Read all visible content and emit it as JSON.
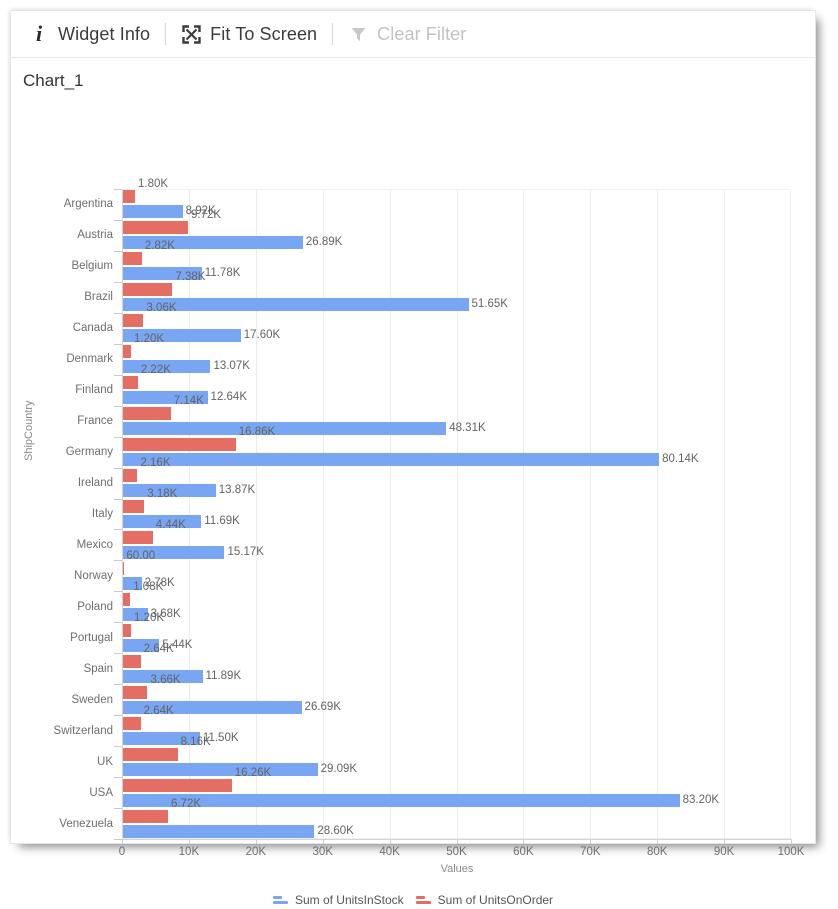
{
  "toolbar": {
    "items": [
      {
        "id": "widget-info",
        "label": "Widget Info",
        "icon": "info-icon",
        "disabled": false
      },
      {
        "id": "fit-to-screen",
        "label": "Fit To Screen",
        "icon": "fit-to-screen-icon",
        "disabled": false
      },
      {
        "id": "clear-filter",
        "label": "Clear Filter",
        "icon": "funnel-icon",
        "disabled": true
      }
    ]
  },
  "chart_title": "Chart_1",
  "colors": {
    "series_in_stock": "#78a6f2",
    "series_on_order": "#e46e64",
    "grid": "#ececec",
    "axis": "#d4d4d4",
    "label_text": "#636363"
  },
  "chart_data": {
    "type": "bar",
    "orientation": "horizontal",
    "title": "Chart_1",
    "xlabel": "Values",
    "ylabel": "ShipCountry",
    "xlim": [
      0,
      100000
    ],
    "xticks": [
      0,
      10000,
      20000,
      30000,
      40000,
      50000,
      60000,
      70000,
      80000,
      90000,
      100000
    ],
    "xtick_labels": [
      "0",
      "10K",
      "20K",
      "30K",
      "40K",
      "50K",
      "60K",
      "70K",
      "80K",
      "90K",
      "100K"
    ],
    "grid": true,
    "legend_position": "bottom",
    "categories": [
      "Argentina",
      "Austria",
      "Belgium",
      "Brazil",
      "Canada",
      "Denmark",
      "Finland",
      "France",
      "Germany",
      "Ireland",
      "Italy",
      "Mexico",
      "Norway",
      "Poland",
      "Portugal",
      "Spain",
      "Sweden",
      "Switzerland",
      "UK",
      "USA",
      "Venezuela"
    ],
    "series": [
      {
        "name": "Sum of UnitsInStock",
        "color": "#78a6f2",
        "values": [
          8920,
          26890,
          11780,
          51650,
          17600,
          13070,
          12640,
          48310,
          80140,
          13870,
          11690,
          15170,
          2780,
          3680,
          5440,
          11890,
          26690,
          11500,
          29090,
          83200,
          28600
        ],
        "labels": [
          "8.92K",
          "26.89K",
          "11.78K",
          "51.65K",
          "17.60K",
          "13.07K",
          "12.64K",
          "48.31K",
          "80.14K",
          "13.87K",
          "11.69K",
          "15.17K",
          "2.78K",
          "3.68K",
          "5.44K",
          "11.89K",
          "26.69K",
          "11.50K",
          "29.09K",
          "83.20K",
          "28.60K"
        ]
      },
      {
        "name": "Sum of UnitsOnOrder",
        "color": "#e46e64",
        "values": [
          1800,
          9720,
          2820,
          7380,
          3060,
          1200,
          2220,
          7140,
          16860,
          2160,
          3180,
          4440,
          60,
          1080,
          1200,
          2640,
          3660,
          2640,
          8160,
          16260,
          6720
        ],
        "labels": [
          "1.80K",
          "9.72K",
          "2.82K",
          "7.38K",
          "3.06K",
          "1.20K",
          "2.22K",
          "7.14K",
          "16.86K",
          "2.16K",
          "3.18K",
          "4.44K",
          "60.00",
          "1.08K",
          "1.20K",
          "2.64K",
          "3.66K",
          "2.64K",
          "8.16K",
          "16.26K",
          "6.72K"
        ]
      }
    ]
  },
  "legend": [
    {
      "label": "Sum of UnitsInStock",
      "color": "#78a6f2"
    },
    {
      "label": "Sum of UnitsOnOrder",
      "color": "#e46e64"
    }
  ]
}
